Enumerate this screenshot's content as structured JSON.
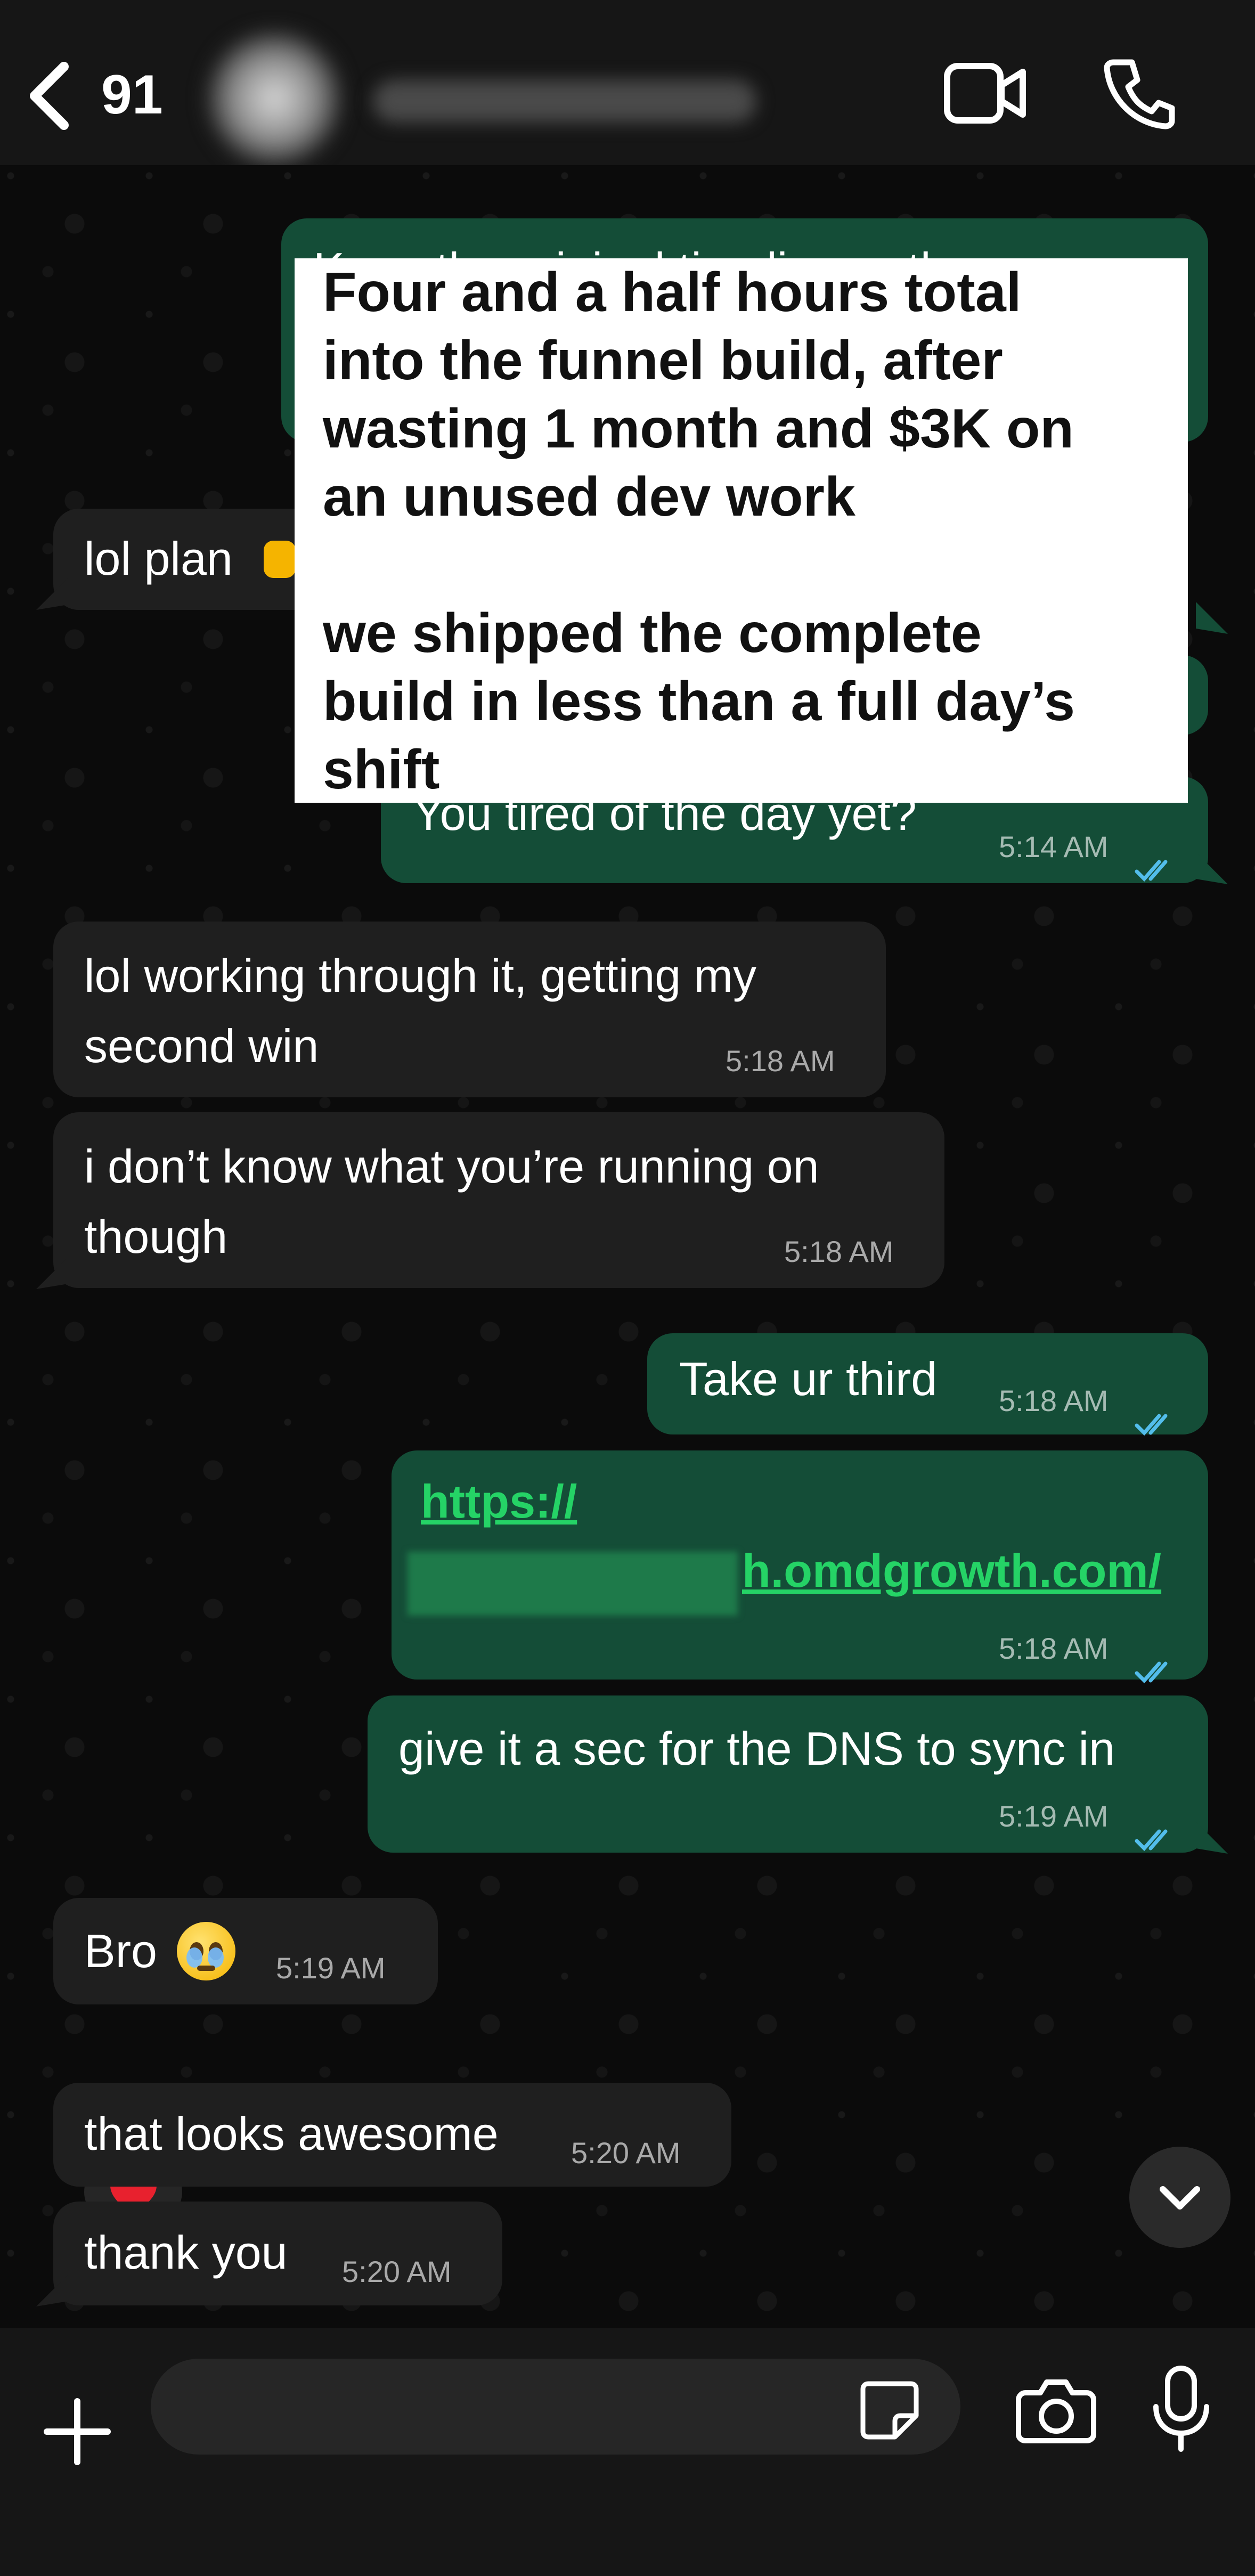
{
  "header": {
    "unread_count": "91"
  },
  "messages": {
    "m1_partial": "Keep the original timeline, rather",
    "m2_text": "lol plan",
    "m3_text": "You tired of the day yet?",
    "m3_time": "5:14 AM",
    "m4_line1": "lol working through it, getting my",
    "m4_line2": "second win",
    "m4_time": "5:18 AM",
    "m5_line1": "i don’t know what you’re running on",
    "m5_line2": "though",
    "m5_time": "5:18 AM",
    "m6_text": "Take ur third",
    "m6_time": "5:18 AM",
    "m7_link1": "https://",
    "m7_link2": "h.omdgrowth.com/",
    "m7_time": "5:18 AM",
    "m8_text": "give it a sec for the DNS to sync in",
    "m8_time": "5:19 AM",
    "m9_text": "Bro",
    "m9_time": "5:19 AM",
    "m10_text": "that looks awesome",
    "m10_time": "5:20 AM",
    "m11_text": "thank you",
    "m11_time": "5:20 AM"
  },
  "note": {
    "line1": "Four and a half hours total",
    "line2": "into the funnel build, after",
    "line3": "wasting 1 month and $3K on",
    "line4": "an unused dev work",
    "line5": "we shipped the complete",
    "line6": "build in less than a full day’s",
    "line7": "shift"
  },
  "composer": {
    "value": ""
  },
  "colors": {
    "incoming_bubble": "#1f1f1f",
    "outgoing_bubble": "#144d37",
    "link": "#25d366",
    "read_ticks": "#53bdeb"
  },
  "icons": {
    "back": "chevron-left-icon",
    "video": "video-camera-icon",
    "call": "phone-icon",
    "plus": "plus-icon",
    "sticker": "sticker-icon",
    "camera": "camera-icon",
    "mic": "microphone-icon",
    "scroll": "chevron-down-icon",
    "reaction": "red-heart-icon"
  }
}
